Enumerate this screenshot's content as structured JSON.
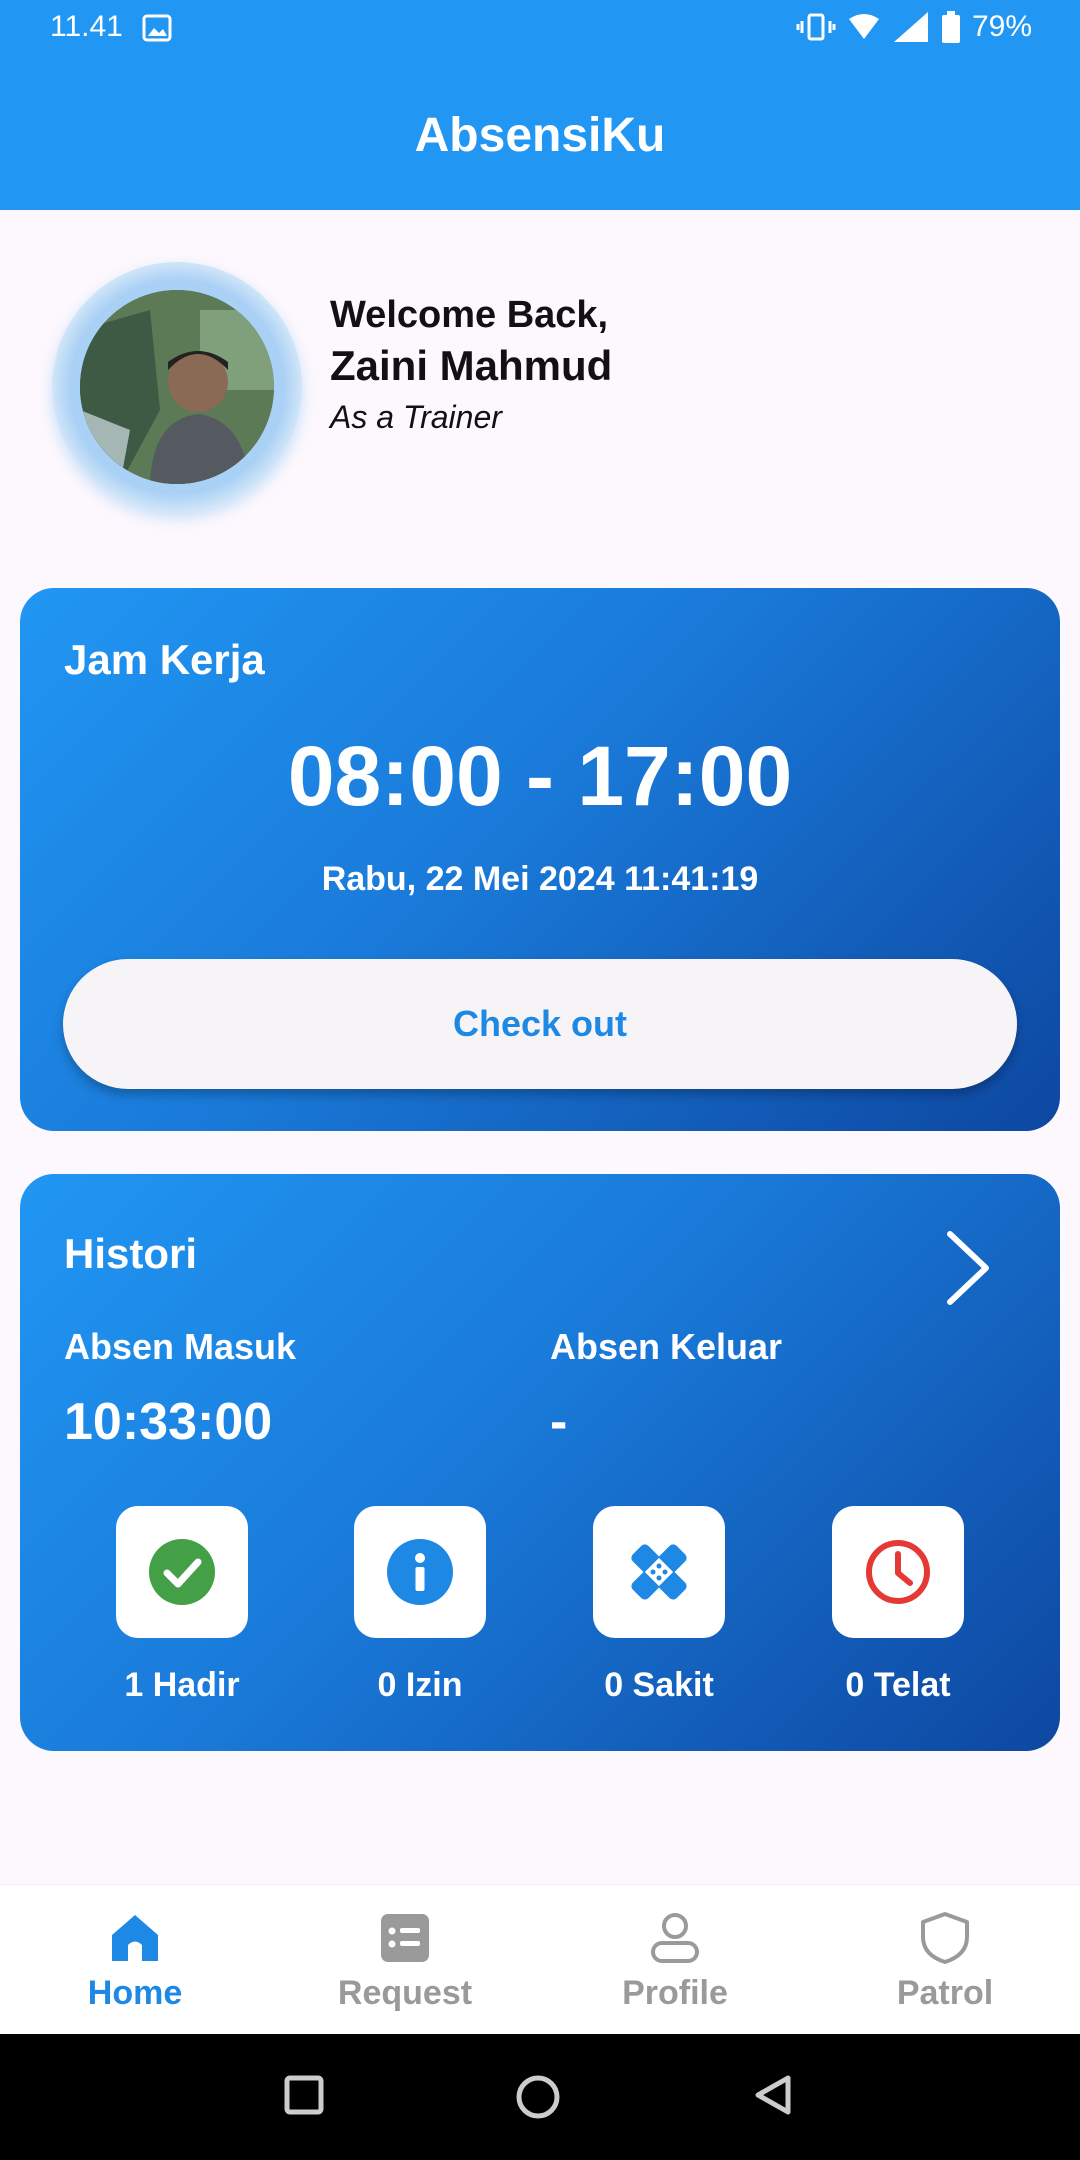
{
  "status_bar": {
    "time": "11.41",
    "battery": "79%"
  },
  "app": {
    "title": "AbsensiKu"
  },
  "welcome": {
    "greeting": "Welcome Back,",
    "name": "Zaini Mahmud",
    "role": "As a Trainer"
  },
  "work_hours_card": {
    "label": "Jam Kerja",
    "hours": "08:00 - 17:00",
    "datetime": "Rabu, 22 Mei 2024 11:41:19",
    "checkout_label": "Check out"
  },
  "history_card": {
    "label": "Histori",
    "in_label": "Absen Masuk",
    "in_value": "10:33:00",
    "out_label": "Absen Keluar",
    "out_value": "-",
    "stats": [
      {
        "label": "1 Hadir",
        "icon": "check-circle-icon",
        "color": "#43a047"
      },
      {
        "label": "0 Izin",
        "icon": "info-icon",
        "color": "#1e88e5"
      },
      {
        "label": "0 Sakit",
        "icon": "bandage-icon",
        "color": "#1e88e5"
      },
      {
        "label": "0 Telat",
        "icon": "clock-icon",
        "color": "#e53935"
      }
    ]
  },
  "bottom_nav": {
    "items": [
      {
        "label": "Home",
        "icon": "home-icon",
        "active": true
      },
      {
        "label": "Request",
        "icon": "list-icon",
        "active": false
      },
      {
        "label": "Profile",
        "icon": "person-icon",
        "active": false
      },
      {
        "label": "Patrol",
        "icon": "shield-icon",
        "active": false
      }
    ]
  },
  "colors": {
    "primary": "#2196f3",
    "primary_dark": "#0d47a1",
    "nav_active": "#1e88e5",
    "nav_inactive": "#9a9a9a"
  }
}
